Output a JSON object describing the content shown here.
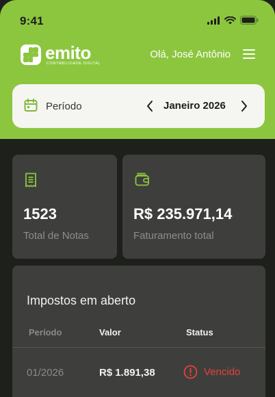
{
  "status_bar": {
    "time": "9:41"
  },
  "header": {
    "logo_word": "emito",
    "logo_sub": "CONTABILIDADE DIGITAL",
    "greeting": "Olá, José Antônio"
  },
  "period": {
    "label": "Período",
    "value": "Janeiro 2026"
  },
  "stats": [
    {
      "value": "1523",
      "label": "Total de Notas",
      "icon": "receipt-icon"
    },
    {
      "value": "R$ 235.971,14",
      "label": "Faturamento total",
      "icon": "wallet-icon"
    }
  ],
  "taxes": {
    "title": "Impostos em aberto",
    "columns": [
      "Período",
      "Valor",
      "Status"
    ],
    "rows": [
      {
        "period": "01/2026",
        "value": "R$ 1.891,38",
        "status": "Vencido"
      }
    ]
  },
  "colors": {
    "brand_green": "#8cc63f",
    "background": "#1e201c",
    "card": "#3e3f3c",
    "alert_red": "#e5413b"
  }
}
